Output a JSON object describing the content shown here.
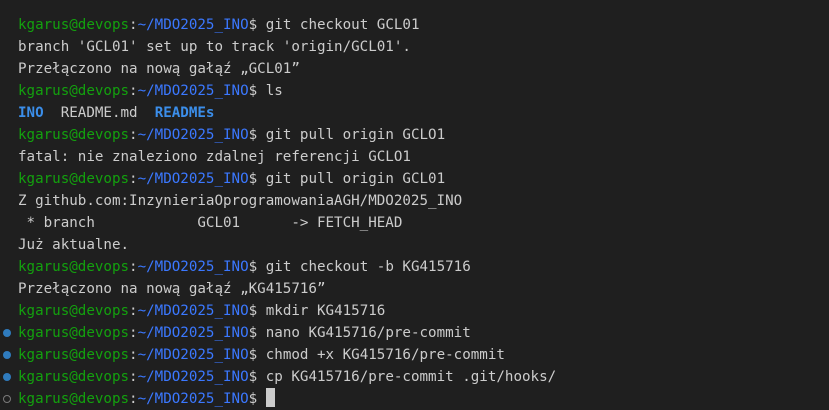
{
  "terminal": {
    "user_host": "kgarus@devops",
    "colon": ":",
    "cwd": "~/MDO2025_INO",
    "dollar": "$",
    "lines": [
      {
        "type": "prompt",
        "command": "git checkout GCL01"
      },
      {
        "type": "output",
        "text": "branch 'GCL01' set up to track 'origin/GCL01'."
      },
      {
        "type": "output",
        "text": "Przełączono na nową gałąź „GCL01”"
      },
      {
        "type": "prompt",
        "command": "ls"
      },
      {
        "type": "ls",
        "items": [
          {
            "name": "INO",
            "kind": "dir"
          },
          {
            "name": "README.md",
            "kind": "file"
          },
          {
            "name": "READMEs",
            "kind": "dir"
          }
        ]
      },
      {
        "type": "prompt",
        "command": "git pull origin GCLO1"
      },
      {
        "type": "output",
        "text": "fatal: nie znaleziono zdalnej referencji GCLO1"
      },
      {
        "type": "prompt",
        "command": "git pull origin GCL01"
      },
      {
        "type": "output",
        "text": "Z github.com:InzynieriaOprogramowaniaAGH/MDO2025_INO"
      },
      {
        "type": "output",
        "text": " * branch            GCL01      -> FETCH_HEAD"
      },
      {
        "type": "output",
        "text": "Już aktualne."
      },
      {
        "type": "prompt",
        "command": "git checkout -b KG415716"
      },
      {
        "type": "output",
        "text": "Przełączono na nową gałąź „KG415716”"
      },
      {
        "type": "prompt",
        "command": "mkdir KG415716"
      },
      {
        "type": "prompt",
        "command": "nano KG415716/pre-commit",
        "marker": "filled"
      },
      {
        "type": "prompt",
        "command": "chmod +x KG415716/pre-commit",
        "marker": "filled"
      },
      {
        "type": "prompt",
        "command": "cp KG415716/pre-commit .git/hooks/",
        "marker": "filled"
      },
      {
        "type": "prompt",
        "command": "",
        "marker": "hollow",
        "cursor": true
      }
    ]
  },
  "colors": {
    "background": "#1f1f1f",
    "user_host": "#13a10e",
    "path": "#3b78ff",
    "text": "#cccccc",
    "directory": "#3b8eea",
    "marker": "#2f7bbd"
  }
}
